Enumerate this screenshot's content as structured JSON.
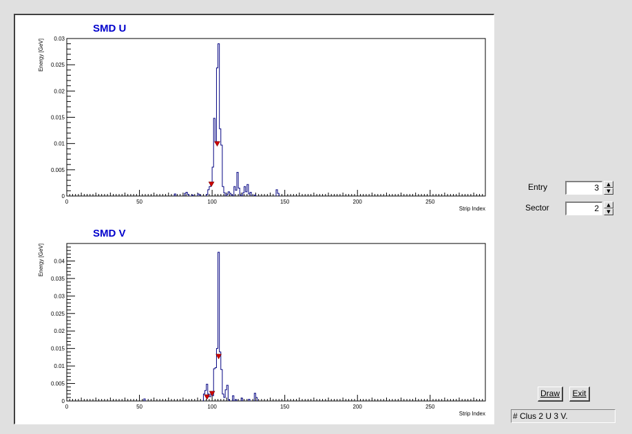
{
  "plots": [
    {
      "title": "SMD U",
      "xlabel": "Strip Index",
      "ylabel": "Energy [GeV]",
      "xlim": [
        0,
        288
      ],
      "ylim": [
        0,
        0.03
      ],
      "xticks": [
        0,
        50,
        100,
        150,
        200,
        250
      ],
      "yticks": [
        "0",
        "0.005",
        "0.01",
        "0.015",
        "0.02",
        "0.025",
        "0.03"
      ]
    },
    {
      "title": "SMD V",
      "xlabel": "Strip Index",
      "ylabel": "Energy [GeV]",
      "xlim": [
        0,
        288
      ],
      "ylim": [
        0,
        0.045
      ],
      "xticks": [
        0,
        50,
        100,
        150,
        200,
        250
      ],
      "yticks": [
        "0",
        "0.005",
        "0.01",
        "0.015",
        "0.02",
        "0.025",
        "0.03",
        "0.035",
        "0.04"
      ]
    }
  ],
  "chart_data": [
    {
      "type": "bar",
      "title": "SMD U",
      "xlabel": "Strip Index",
      "ylabel": "Energy [GeV]",
      "ylim": [
        0,
        0.03
      ],
      "xlim": [
        0,
        288
      ],
      "line_color": "#000080",
      "marker_color": "#cc0000",
      "bins": [
        [
          74,
          0.0004
        ],
        [
          81,
          0.0005
        ],
        [
          82,
          0.0007
        ],
        [
          83,
          0.0003
        ],
        [
          86,
          0.0002
        ],
        [
          90,
          0.0004
        ],
        [
          91,
          0.0002
        ],
        [
          96,
          0.0003
        ],
        [
          97,
          0.0012
        ],
        [
          98,
          0.0018
        ],
        [
          99,
          0.0025
        ],
        [
          100,
          0.0055
        ],
        [
          101,
          0.0148
        ],
        [
          102,
          0.0102
        ],
        [
          103,
          0.0244
        ],
        [
          104,
          0.029
        ],
        [
          105,
          0.0128
        ],
        [
          106,
          0.0097
        ],
        [
          107,
          0.0018
        ],
        [
          108,
          0.0006
        ],
        [
          110,
          0.0003
        ],
        [
          111,
          0.0008
        ],
        [
          112,
          0.0005
        ],
        [
          113,
          0.0002
        ],
        [
          115,
          0.0018
        ],
        [
          116,
          0.0011
        ],
        [
          117,
          0.0045
        ],
        [
          118,
          0.0015
        ],
        [
          119,
          0.0002
        ],
        [
          121,
          0.0006
        ],
        [
          122,
          0.0018
        ],
        [
          123,
          0.0008
        ],
        [
          124,
          0.0022
        ],
        [
          125,
          0.0004
        ],
        [
          126,
          0.0007
        ],
        [
          129,
          0.0002
        ],
        [
          144,
          0.0012
        ],
        [
          145,
          0.0005
        ]
      ],
      "markers": [
        [
          99.5,
          0.0023
        ],
        [
          103.5,
          0.01
        ]
      ]
    },
    {
      "type": "bar",
      "title": "SMD V",
      "xlabel": "Strip Index",
      "ylabel": "Energy [GeV]",
      "ylim": [
        0,
        0.045
      ],
      "xlim": [
        0,
        288
      ],
      "line_color": "#000080",
      "marker_color": "#cc0000",
      "bins": [
        [
          53,
          0.0006
        ],
        [
          94,
          0.002
        ],
        [
          95,
          0.003
        ],
        [
          96,
          0.0048
        ],
        [
          97,
          0.002
        ],
        [
          98,
          0.0012
        ],
        [
          99,
          0.0025
        ],
        [
          100,
          0.0015
        ],
        [
          101,
          0.0092
        ],
        [
          102,
          0.0095
        ],
        [
          103,
          0.015
        ],
        [
          104,
          0.0425
        ],
        [
          105,
          0.014
        ],
        [
          106,
          0.009
        ],
        [
          107,
          0.002
        ],
        [
          108,
          0.001
        ],
        [
          109,
          0.0032
        ],
        [
          110,
          0.0045
        ],
        [
          111,
          0.0003
        ],
        [
          114,
          0.0015
        ],
        [
          116,
          0.0004
        ],
        [
          120,
          0.0008
        ],
        [
          125,
          0.0005
        ],
        [
          129,
          0.0022
        ],
        [
          130,
          0.001
        ]
      ],
      "markers": [
        [
          96.5,
          0.0012
        ],
        [
          100.0,
          0.0022
        ],
        [
          104.5,
          0.0128
        ]
      ]
    }
  ],
  "controls": {
    "entry_label": "Entry",
    "entry_value": "3",
    "sector_label": "Sector",
    "sector_value": "2",
    "spin_up": "▲",
    "spin_down": "▼",
    "draw_label": "Draw",
    "exit_label": "Exit"
  },
  "status": {
    "text": "# Clus 2 U 3 V."
  }
}
